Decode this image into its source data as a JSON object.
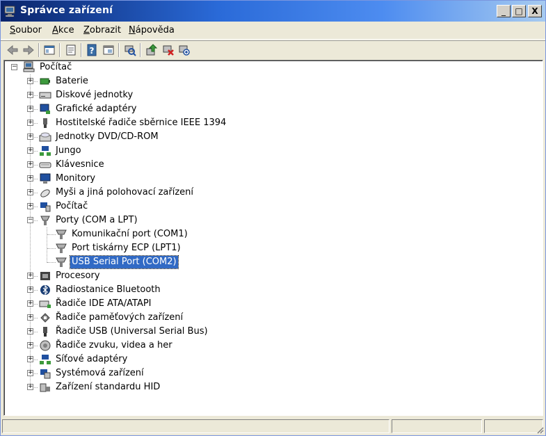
{
  "window": {
    "title": "Správce zařízení"
  },
  "titlebar_buttons": {
    "minimize": "_",
    "maximize": "□",
    "close": "X"
  },
  "menu": {
    "items": [
      {
        "label": "Soubor",
        "accel": "S"
      },
      {
        "label": "Akce",
        "accel": "A"
      },
      {
        "label": "Zobrazit",
        "accel": "Z"
      },
      {
        "label": "Nápověda",
        "accel": "N"
      }
    ]
  },
  "toolbar": {
    "buttons": [
      "back-icon",
      "forward-icon",
      "console-tree-icon",
      "properties-icon",
      "help-icon",
      "view-icon",
      "scan-hardware-icon",
      "update-driver-icon",
      "uninstall-icon",
      "disable-icon"
    ]
  },
  "tree": {
    "root": "Počítač",
    "categories": [
      {
        "label": "Baterie",
        "icon": "battery-icon"
      },
      {
        "label": "Diskové jednotky",
        "icon": "disk-drive-icon"
      },
      {
        "label": "Grafické adaptéry",
        "icon": "display-adapter-icon"
      },
      {
        "label": "Hostitelské řadiče sběrnice IEEE 1394",
        "icon": "firewire-icon"
      },
      {
        "label": "Jednotky DVD/CD-ROM",
        "icon": "cdrom-icon"
      },
      {
        "label": "Jungo",
        "icon": "network-icon"
      },
      {
        "label": "Klávesnice",
        "icon": "keyboard-icon"
      },
      {
        "label": "Monitory",
        "icon": "monitor-icon"
      },
      {
        "label": "Myši a jiná polohovací zařízení",
        "icon": "mouse-icon"
      },
      {
        "label": "Počítač",
        "icon": "computer-icon"
      },
      {
        "label": "Porty (COM a LPT)",
        "icon": "port-icon",
        "expanded": true,
        "children": [
          {
            "label": "Komunikační port (COM1)"
          },
          {
            "label": "Port tiskárny ECP (LPT1)"
          },
          {
            "label": "USB Serial Port (COM2)",
            "selected": true
          }
        ]
      },
      {
        "label": "Procesory",
        "icon": "processor-icon"
      },
      {
        "label": "Radiostanice Bluetooth",
        "icon": "bluetooth-icon"
      },
      {
        "label": "Řadiče IDE ATA/ATAPI",
        "icon": "ide-icon"
      },
      {
        "label": "Řadiče paměťových zařízení",
        "icon": "storage-icon"
      },
      {
        "label": "Řadiče USB (Universal Serial Bus)",
        "icon": "usb-icon"
      },
      {
        "label": "Řadiče zvuku, videa a her",
        "icon": "sound-icon"
      },
      {
        "label": "Síťové adaptéry",
        "icon": "network-adapter-icon"
      },
      {
        "label": "Systémová zařízení",
        "icon": "system-icon"
      },
      {
        "label": "Zařízení standardu HID",
        "icon": "hid-icon"
      }
    ]
  },
  "statusbar": {
    "panes": [
      "",
      "",
      ""
    ]
  }
}
